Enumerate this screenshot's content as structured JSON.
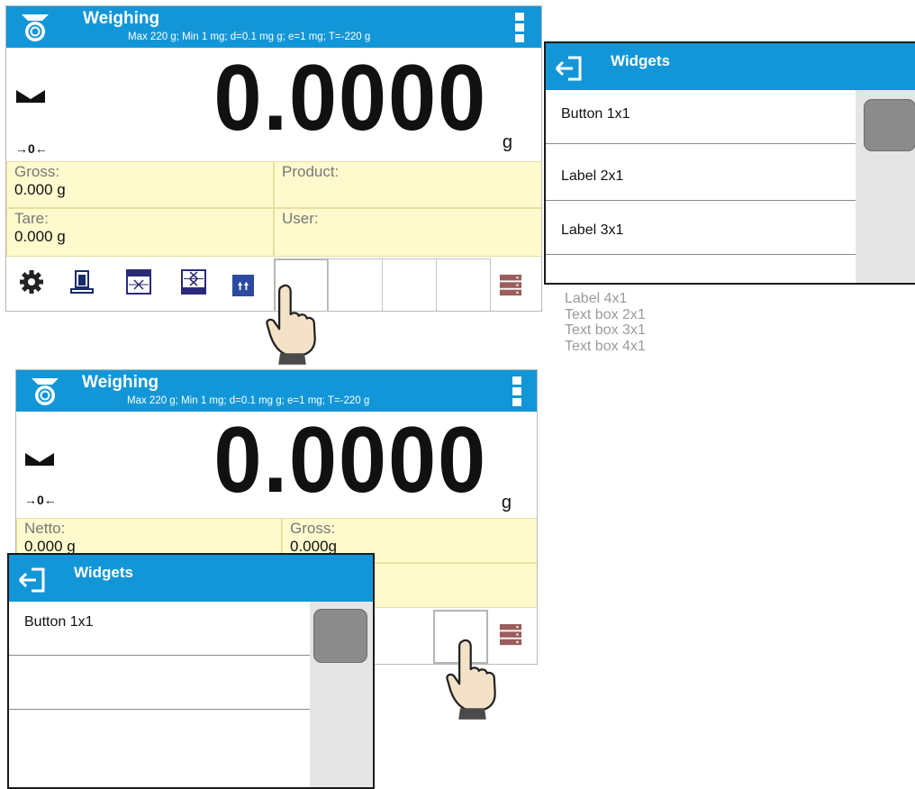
{
  "weighing_top": {
    "title": "Weighing",
    "subtitle": "Max 220 g; Min 1 mg; d=0.1 mg g; e=1 mg; T=-220 g",
    "value": "0.0000",
    "unit": "g",
    "zero_indicator": "→0←",
    "fields": [
      {
        "label": "Gross:",
        "value": "0.000 g"
      },
      {
        "label": "Product:",
        "value": ""
      },
      {
        "label": "Tare:",
        "value": "0.000 g"
      },
      {
        "label": "User:",
        "value": ""
      }
    ],
    "toolbar_icons": [
      "settings-gear-icon",
      "tare-icon",
      "function-x-icon",
      "function-xx-icon",
      "up-arrows-icon",
      "database-icon"
    ]
  },
  "weighing_bottom": {
    "title": "Weighing",
    "subtitle": "Max 220 g; Min 1 mg; d=0.1 mg g; e=1 mg; T=-220 g",
    "value": "0.0000",
    "unit": "g",
    "zero_indicator": "→0←",
    "fields": [
      {
        "label": "Netto:",
        "value": "0.000 g"
      },
      {
        "label": "Gross:",
        "value": "0.000g"
      }
    ]
  },
  "widgets_top": {
    "title": "Widgets",
    "items": [
      "Button 1x1",
      "Label 2x1",
      "Label 3x1",
      ""
    ]
  },
  "widgets_overflow": [
    "Label 4x1",
    "Text box 2x1",
    "Text box 3x1",
    "Text box 4x1"
  ],
  "widgets_bottom": {
    "title": "Widgets",
    "items": [
      "Button 1x1",
      "",
      ""
    ]
  },
  "colors": {
    "header_blue": "#1296d8",
    "info_yellow": "#fffacd",
    "knob_gray": "#8b8b8b"
  }
}
